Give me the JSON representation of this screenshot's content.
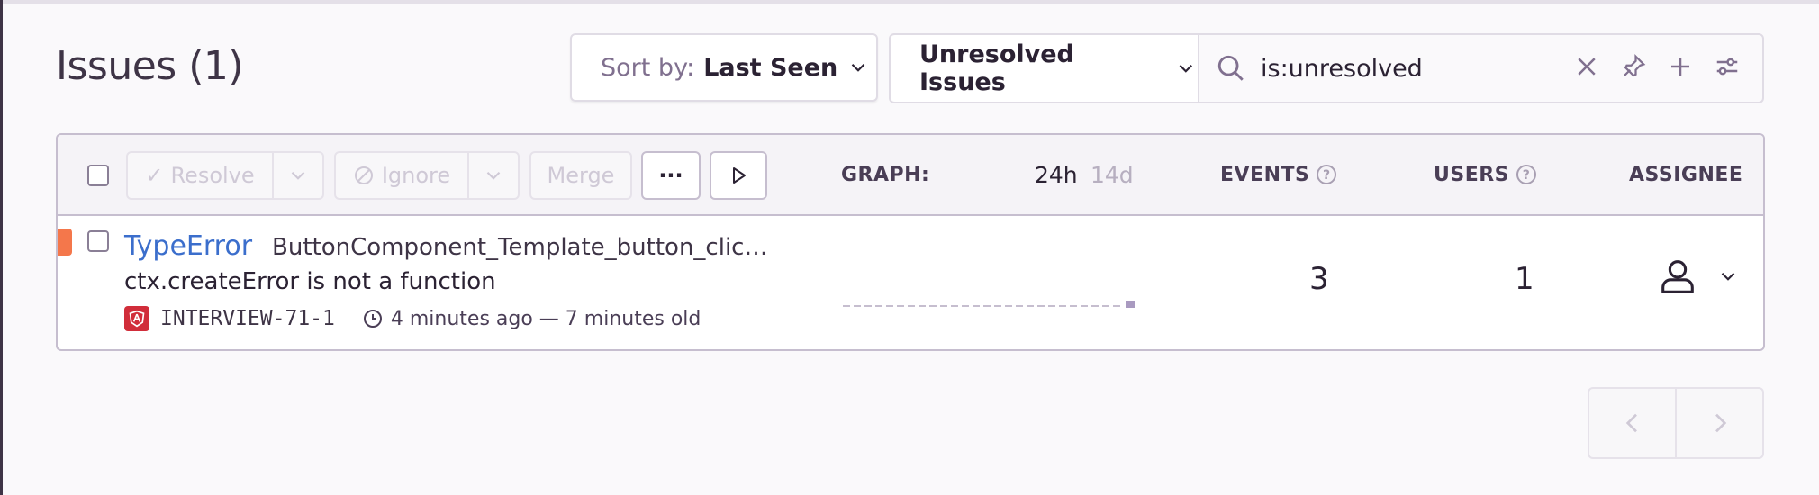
{
  "header": {
    "title": "Issues (1)",
    "sort": {
      "label": "Sort by:",
      "value": "Last Seen"
    },
    "saved_search": "Unresolved Issues",
    "search": {
      "value": "is:unresolved"
    }
  },
  "toolbar": {
    "resolve": "Resolve",
    "ignore": "Ignore",
    "merge": "Merge",
    "more": "···",
    "graph_label": "GRAPH:",
    "period_24h": "24h",
    "period_14d": "14d",
    "events_label": "EVENTS",
    "users_label": "USERS",
    "assignee_label": "ASSIGNEE"
  },
  "issues": [
    {
      "type": "TypeError",
      "culprit": "ButtonComponent_Template_button_clic…",
      "message": "ctx.createError is not a function",
      "project": "INTERVIEW-71-1",
      "time": "4 minutes ago — 7 minutes old",
      "events": "3",
      "users": "1",
      "level_color": "#f4774b"
    }
  ],
  "colors": {
    "accent": "#3b6ecc",
    "project_icon": "#d12d3a"
  }
}
